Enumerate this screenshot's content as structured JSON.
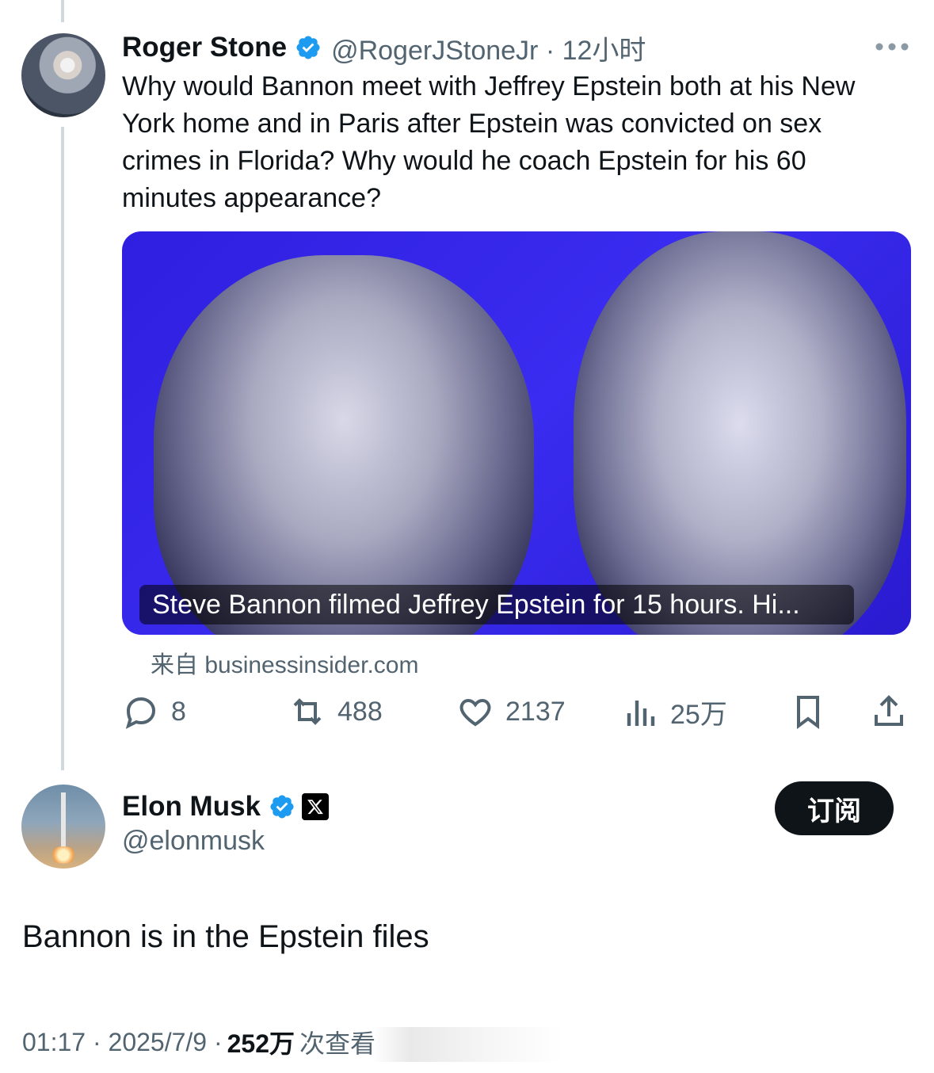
{
  "original_tweet": {
    "author": {
      "name": "Roger Stone",
      "handle": "@RogerJStoneJr",
      "time": "· 12小时"
    },
    "text": "Why would Bannon meet with Jeffrey Epstein both at his New York home and in Paris after Epstein was convicted on sex crimes in Florida? Why would he coach Epstein for his 60 minutes appearance?",
    "card": {
      "caption": "Steve Bannon filmed Jeffrey Epstein for 15 hours. Hi...",
      "source": "来自 businessinsider.com"
    },
    "actions": {
      "replies": "8",
      "reposts": "488",
      "likes": "2137",
      "views": "25万"
    }
  },
  "reply": {
    "author": {
      "name": "Elon Musk",
      "handle": "@elonmusk"
    },
    "subscribe_label": "订阅",
    "text": "Bannon is in the Epstein files",
    "meta": {
      "time_date": "01:17 · 2025/7/9 ·",
      "views_count": "252万",
      "views_label": "次查看"
    }
  },
  "colors": {
    "verified": "#1d9bf0",
    "text": "#0f1419",
    "secondary": "#536471",
    "thread": "#cfd9de"
  }
}
